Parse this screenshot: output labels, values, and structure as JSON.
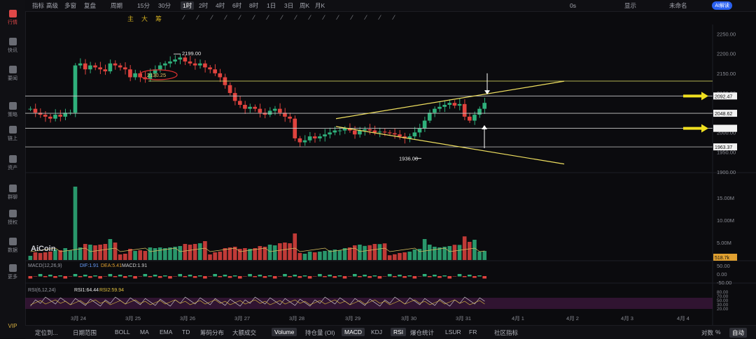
{
  "sidebar": {
    "items": [
      {
        "label": "行情",
        "icon": "bar-chart-icon",
        "active": true
      },
      {
        "label": "快讯",
        "icon": "news-icon"
      },
      {
        "label": "要闻",
        "icon": "document-icon"
      },
      {
        "label": "策略",
        "icon": "strategy-icon"
      },
      {
        "label": "链上",
        "icon": "chain-icon"
      },
      {
        "label": "资产",
        "icon": "wallet-icon"
      },
      {
        "label": "群聊",
        "icon": "chat-icon"
      },
      {
        "label": "授权",
        "icon": "key-icon"
      },
      {
        "label": "数据",
        "icon": "database-icon"
      },
      {
        "label": "更多",
        "icon": "grid-icon"
      },
      {
        "label": "VIP",
        "icon": "vip-icon"
      }
    ]
  },
  "topbar": {
    "items": [
      "指标",
      "高级",
      "多窗",
      "复盘",
      "周期",
      "15分",
      "30分",
      "1时",
      "2时",
      "4时",
      "6时",
      "8时",
      "1日",
      "3日",
      "周K",
      "月K"
    ],
    "active": "1时",
    "right": {
      "timer": "0s",
      "display": "显示",
      "unread": "未命名",
      "ai": "AI解读"
    }
  },
  "toolbar2": {
    "items": [
      "主",
      "大",
      "筹"
    ]
  },
  "chart_data": {
    "type": "candlestick",
    "price_axis": {
      "ticks": [
        "2250.00",
        "2200.00",
        "2150.00",
        "2100.00",
        "2050.00",
        "2000.00",
        "1950.00",
        "1900.00"
      ],
      "range": [
        1875,
        2265
      ]
    },
    "x_ticks": [
      "3月 24",
      "3月 25",
      "3月 26",
      "3月 27",
      "3月 28",
      "3月 29",
      "3月 30",
      "3月 31",
      "4月 1",
      "4月 2",
      "4月 3",
      "4月 4"
    ],
    "annotations": {
      "high_label": "2199.00",
      "low_label": "1936.00",
      "circled_label": "2130.25",
      "horizontal_levels": [
        {
          "value": "2092.47",
          "color": "#ffffff"
        },
        {
          "value": "2048.62",
          "color": "#ffffff"
        },
        {
          "value": "2010.48",
          "color": "#ffffff"
        },
        {
          "value": "1963.37",
          "color": "#ffffff"
        },
        {
          "value": "2130.25",
          "color": "#e8e86a"
        }
      ],
      "last_price": "2010.48"
    },
    "closes": [
      2060,
      2050,
      2045,
      2040,
      2035,
      2045,
      2040,
      2050,
      2050,
      2170,
      2175,
      2160,
      2170,
      2165,
      2160,
      2155,
      2175,
      2170,
      2165,
      2160,
      2140,
      2150,
      2140,
      2135,
      2150,
      2160,
      2170,
      2175,
      2180,
      2185,
      2190,
      2180,
      2175,
      2170,
      2175,
      2165,
      2160,
      2150,
      2140,
      2120,
      2100,
      2080,
      2070,
      2060,
      2065,
      2060,
      2050,
      2045,
      2055,
      2060,
      2050,
      2040,
      2035,
      1985,
      1975,
      1980,
      1990,
      1985,
      1990,
      1995,
      2000,
      2005,
      2005,
      2010,
      2005,
      1995,
      2005,
      2008,
      2005,
      2000,
      2002,
      2000,
      1998,
      1995,
      1990,
      1985,
      1990,
      2000,
      2010,
      2030,
      2050,
      2060,
      2065,
      2070,
      2075,
      2068,
      2072,
      2040,
      2030,
      2045,
      2060,
      2075
    ],
    "volume": {
      "axis": [
        "15.00M",
        "10.00M",
        "5.00M"
      ],
      "last": "518.7k"
    },
    "macd": {
      "label": "MACD(12,26,9)",
      "dif": "DIF:1.91",
      "dea": "DEA:5.41",
      "macd": "MACD:1.91",
      "axis": [
        "50.00",
        "0.00",
        "-50.00"
      ]
    },
    "rsi": {
      "label": "RSI(6,12,24)",
      "rsi1": "RSI1:64.44",
      "rsi2": "RSI2:59.94",
      "axis": [
        "80.00",
        "70.00",
        "50.00",
        "30.00",
        "20.00"
      ]
    }
  },
  "bottom": {
    "items": [
      "定位到...",
      "日期范围",
      "BOLL",
      "MA",
      "EMA",
      "TD",
      "筹码分布",
      "大额成交",
      "Volume",
      "持仓量 (OI)",
      "MACD",
      "KDJ",
      "RSI",
      "爆仓统计",
      "LSUR",
      "FR",
      "社区指标"
    ],
    "active": [
      "Volume",
      "MACD",
      "RSI"
    ],
    "right": [
      "对数",
      "%",
      "自动"
    ]
  },
  "watermark": "AiCoin"
}
